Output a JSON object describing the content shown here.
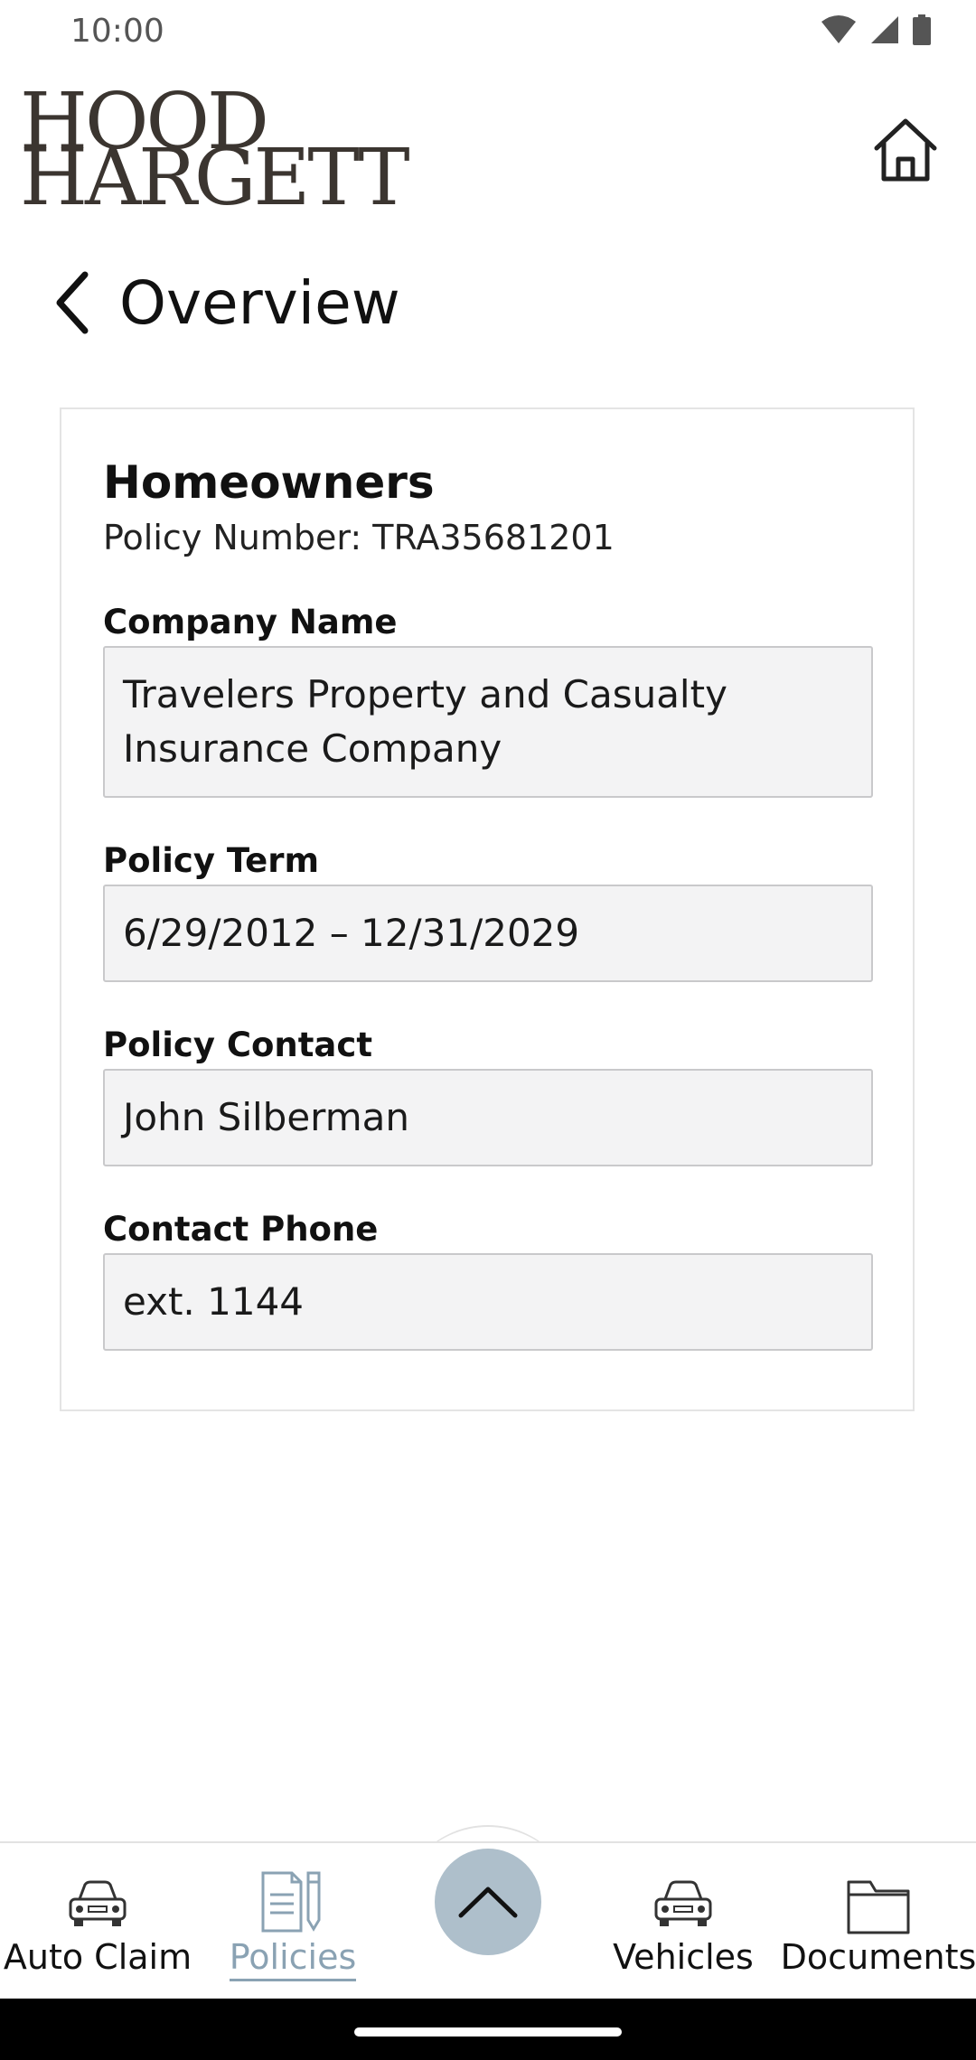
{
  "status_bar": {
    "time": "10:00"
  },
  "logo": {
    "line1": "HOOD",
    "line2": "HARGETT"
  },
  "header": {
    "title": "Overview"
  },
  "policy": {
    "type": "Homeowners",
    "policy_number_label": "Policy Number:",
    "policy_number": "TRA35681201",
    "fields": [
      {
        "label": "Company Name",
        "value": "Travelers Property and Casualty Insurance Company"
      },
      {
        "label": "Policy Term",
        "value": "6/29/2012 – 12/31/2029"
      },
      {
        "label": "Policy Contact",
        "value": "John Silberman"
      },
      {
        "label": "Contact Phone",
        "value": "ext. 1144"
      }
    ]
  },
  "bottom_nav": {
    "items": [
      {
        "label": "Auto Claim",
        "icon": "car-icon"
      },
      {
        "label": "Policies",
        "icon": "policies-icon",
        "active": true
      },
      {
        "label": "Vehicles",
        "icon": "car-icon"
      },
      {
        "label": "Documents",
        "icon": "folder-icon"
      }
    ],
    "center_button_icon": "chevron-up-icon",
    "active_color": "#8aa2b3"
  }
}
